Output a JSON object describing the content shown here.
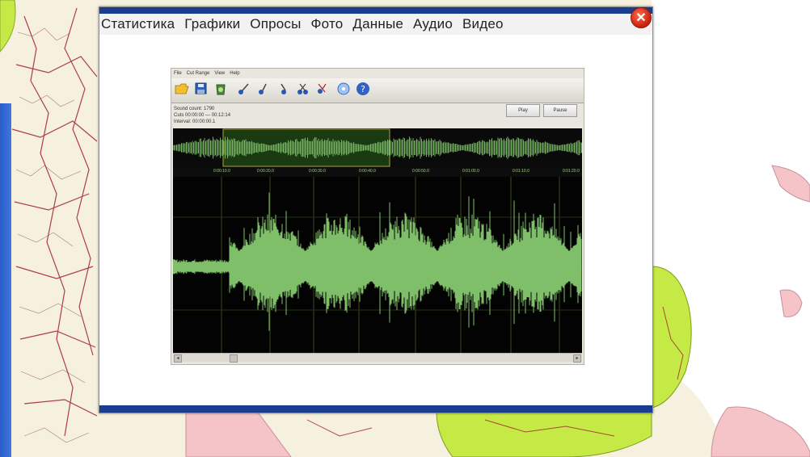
{
  "window": {
    "menu": [
      "Статистика",
      "Графики",
      "Опросы",
      "Фото",
      "Данные",
      "Аудио",
      "Видео"
    ],
    "close_label": "✕"
  },
  "audio_app": {
    "menu": [
      "File",
      "Cut Range",
      "View",
      "Help"
    ],
    "info_lines": [
      "Sound count: 1790",
      "Cuts 00:00:00 — 00:12:14",
      "Interval: 00:00:00.1"
    ],
    "buttons": {
      "play": "Play",
      "pause": "Pause"
    },
    "timeline_labels": [
      "0:00:10.0",
      "0:00:20.0",
      "0:00:30.0",
      "0:00:40.0",
      "0:00:50.0",
      "0:01:00.0",
      "0:01:10.0",
      "0:01:20.0"
    ],
    "toolbar_icons": [
      "open-folder-icon",
      "save-icon",
      "recycle-icon",
      "cut-icon",
      "cut-start-icon",
      "cut-end-icon",
      "scissors-icon",
      "cd-icon",
      "help-icon"
    ]
  },
  "colors": {
    "title_bar": "#1a3d8f",
    "close_button": "#d7260f",
    "waveform": "#7fbf6a",
    "wave_background": "#030303"
  }
}
